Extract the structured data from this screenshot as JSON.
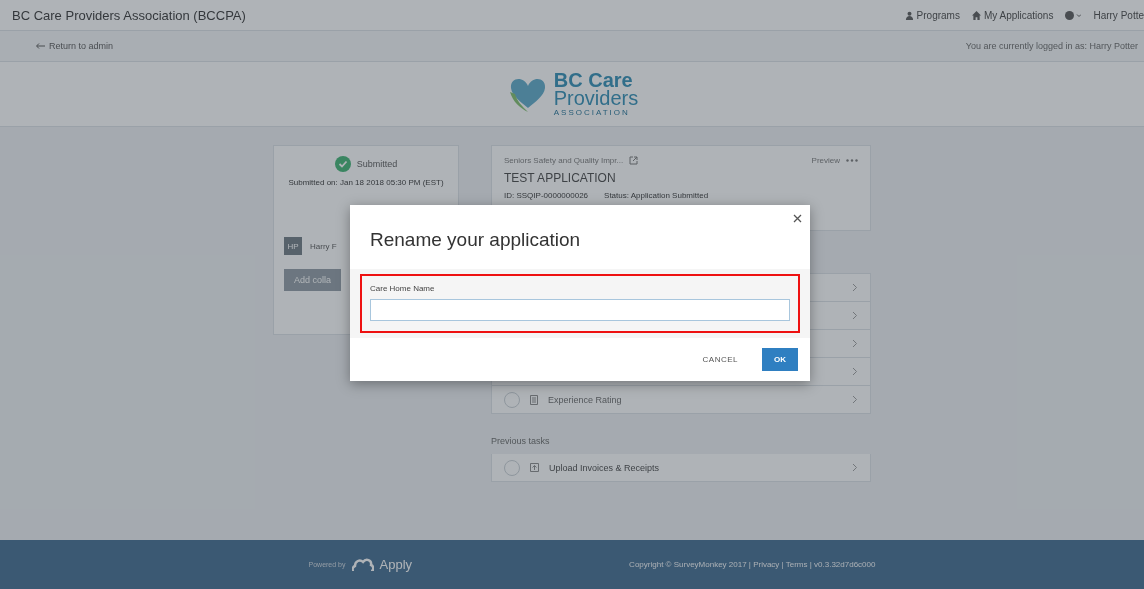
{
  "top_bar": {
    "title": "BC Care Providers Association (BCCPA)",
    "links": [
      {
        "kind": "programs",
        "label": "Programs"
      },
      {
        "kind": "applications",
        "label": "My Applications"
      },
      {
        "kind": "help"
      },
      {
        "kind": "user",
        "label": "Harry Potte"
      }
    ]
  },
  "sub_bar": {
    "back_link": "Return to admin",
    "logged_in": "You are currently logged in as: Harry Potter"
  },
  "logo": {
    "line_1": "BC Care",
    "line_2": "Providers",
    "line_3": "ASSOCIATION"
  },
  "status_card": {
    "status": "Submitted",
    "submitted_on": "Submitted on: Jan 18 2018 05:30 PM (EST)",
    "avatar": "HP",
    "user_name": "Harry F",
    "button": "Add colla"
  },
  "application_card": {
    "program": "Seniors Safety and Quality Impr...",
    "preview": "Preview",
    "title": "TEST APPLICATION",
    "id": "ID: SSQIP-0000000026",
    "status": "Status: Application Submitted"
  },
  "tasks": [
    {
      "kind": "covered"
    },
    {
      "kind": "covered"
    },
    {
      "kind": "covered"
    },
    {
      "kind": "covered"
    },
    {
      "kind": "task",
      "label": "Experience Rating"
    }
  ],
  "previous_tasks": {
    "heading": "Previous tasks",
    "items": [
      {
        "kind": "upload",
        "label": "Upload Invoices & Receipts"
      }
    ]
  },
  "footer": {
    "powered_by": "Powered by",
    "brand": "Apply",
    "copyright": "Copyright © SurveyMonkey 2017 | Privacy | Terms | v0.3.32d7d6c000"
  },
  "dialog": {
    "title": "Rename your application",
    "field_label": "Care Home Name",
    "field_highlighted": true,
    "cancel": "CANCEL",
    "ok": "OK"
  }
}
